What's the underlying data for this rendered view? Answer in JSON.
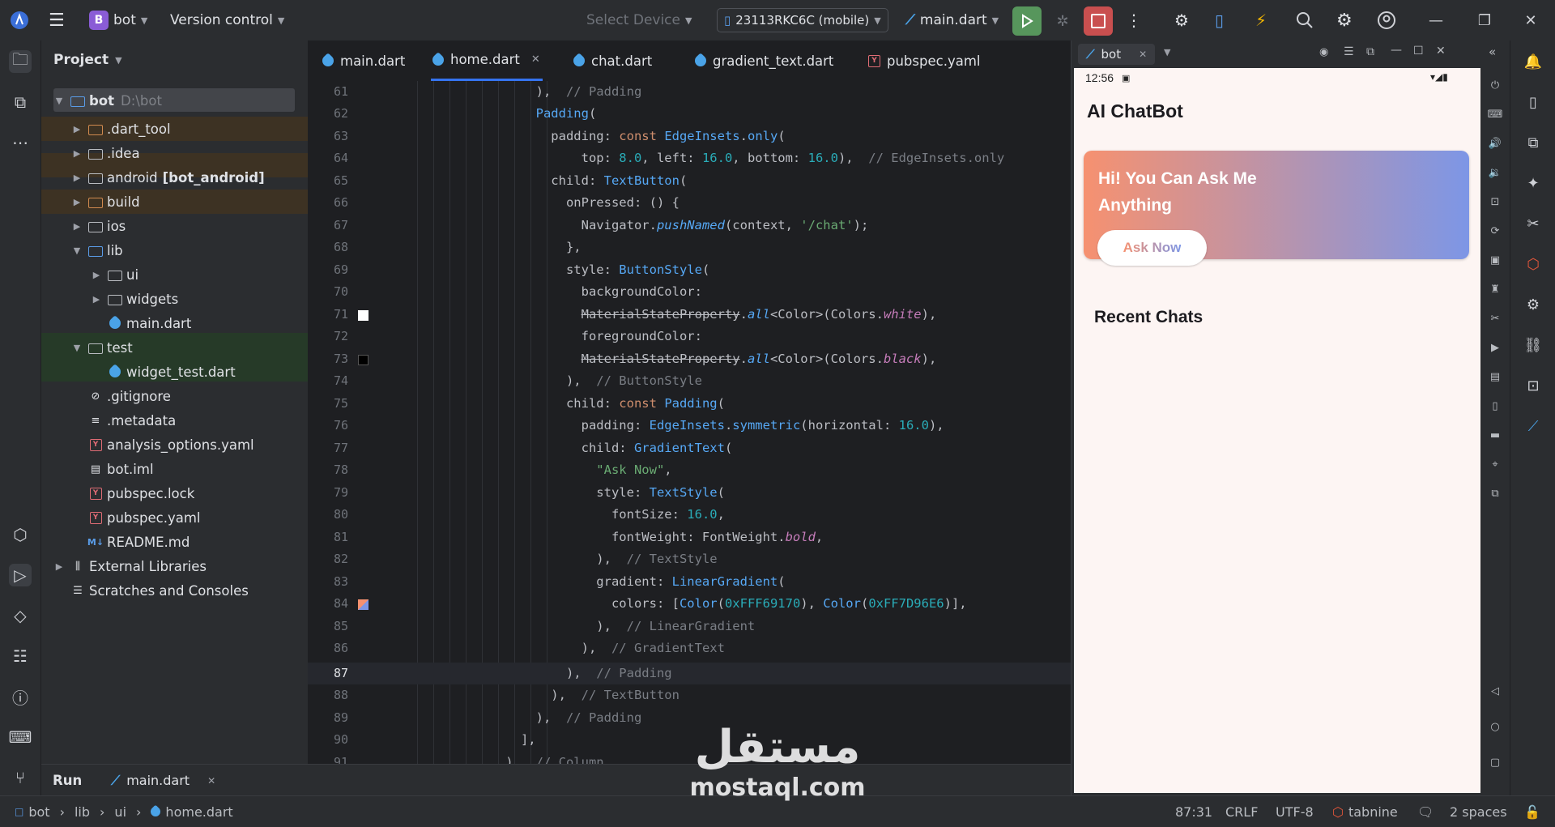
{
  "topbar": {
    "project_badge": "B",
    "project_name": "bot",
    "vcs_label": "Version control",
    "device_selector": "Select Device",
    "device_name": "23113RKC6C (mobile)",
    "run_config": "main.dart"
  },
  "project_panel": {
    "title": "Project",
    "tree": [
      {
        "label": "bot",
        "suffix": "D:\\bot"
      },
      {
        "label": ".dart_tool"
      },
      {
        "label": ".idea"
      },
      {
        "label": "android",
        "suffix": "[bot_android]"
      },
      {
        "label": "build"
      },
      {
        "label": "ios"
      },
      {
        "label": "lib"
      },
      {
        "label": "ui"
      },
      {
        "label": "widgets"
      },
      {
        "label": "main.dart"
      },
      {
        "label": "test"
      },
      {
        "label": "widget_test.dart"
      },
      {
        "label": ".gitignore"
      },
      {
        "label": ".metadata"
      },
      {
        "label": "analysis_options.yaml"
      },
      {
        "label": "bot.iml"
      },
      {
        "label": "pubspec.lock"
      },
      {
        "label": "pubspec.yaml"
      },
      {
        "label": "README.md"
      },
      {
        "label": "External Libraries"
      },
      {
        "label": "Scratches and Consoles"
      }
    ]
  },
  "editor": {
    "tabs": [
      "main.dart",
      "home.dart",
      "chat.dart",
      "gradient_text.dart",
      "pubspec.yaml"
    ],
    "active_tab": "home.dart",
    "line_numbers": [
      "61",
      "62",
      "63",
      "64",
      "65",
      "66",
      "67",
      "68",
      "69",
      "70",
      "71",
      "72",
      "73",
      "74",
      "75",
      "76",
      "77",
      "78",
      "79",
      "80",
      "81",
      "82",
      "83",
      "84",
      "85",
      "86",
      "87",
      "88",
      "89",
      "90",
      "91"
    ]
  },
  "emulator": {
    "tab_label": "bot",
    "status_time": "12:56",
    "app_title": "AI ChatBot",
    "card_title": "Hi! You Can Ask Me Anything",
    "card_button": "Ask Now",
    "section_title": "Recent Chats",
    "gradient_start": "#F69170",
    "gradient_end": "#7D96E6"
  },
  "runbar": {
    "label": "Run",
    "config": "main.dart"
  },
  "statusbar": {
    "breadcrumb": [
      "bot",
      "lib",
      "ui",
      "home.dart"
    ],
    "position": "87:31",
    "line_ending": "CRLF",
    "encoding": "UTF-8",
    "plugin": "tabnine",
    "indent": "2 spaces"
  },
  "watermark": {
    "arabic": "مستقل",
    "latin": "mostaql.com"
  }
}
